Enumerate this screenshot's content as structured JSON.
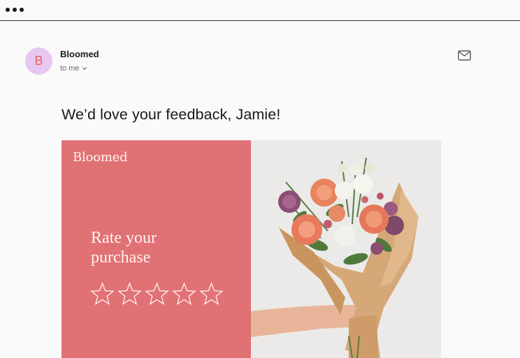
{
  "window": {
    "menu_icon": "three-dots-icon"
  },
  "email": {
    "avatar_initial": "B",
    "sender": "Bloomed",
    "recipient": "to me",
    "subject": "We’d love your feedback, Jamie!"
  },
  "banner": {
    "brand": "Bloomed",
    "rate_line1": "Rate your",
    "rate_line2": "purchase",
    "star_count": 5,
    "colors": {
      "left_bg": "#e07175",
      "text": "#fff4ef",
      "right_bg": "#ebeae8"
    }
  }
}
